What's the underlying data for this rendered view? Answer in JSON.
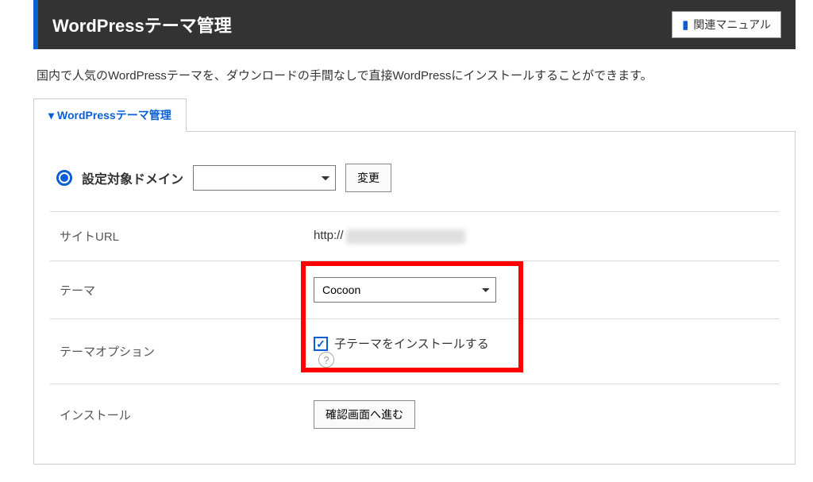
{
  "header": {
    "title": "WordPressテーマ管理",
    "manual_button": "関連マニュアル"
  },
  "intro": "国内で人気のWordPressテーマを、ダウンロードの手間なしで直接WordPressにインストールすることができます。",
  "tab": {
    "label": "WordPressテーマ管理"
  },
  "domain_row": {
    "label": "設定対象ドメイン",
    "change_button": "変更"
  },
  "rows": {
    "site_url_label": "サイトURL",
    "site_url_prefix": "http://",
    "theme_label": "テーマ",
    "theme_value": "Cocoon",
    "option_label": "テーマオプション",
    "option_checkbox": "子テーマをインストールする",
    "install_label": "インストール",
    "install_button": "確認画面へ進む"
  }
}
